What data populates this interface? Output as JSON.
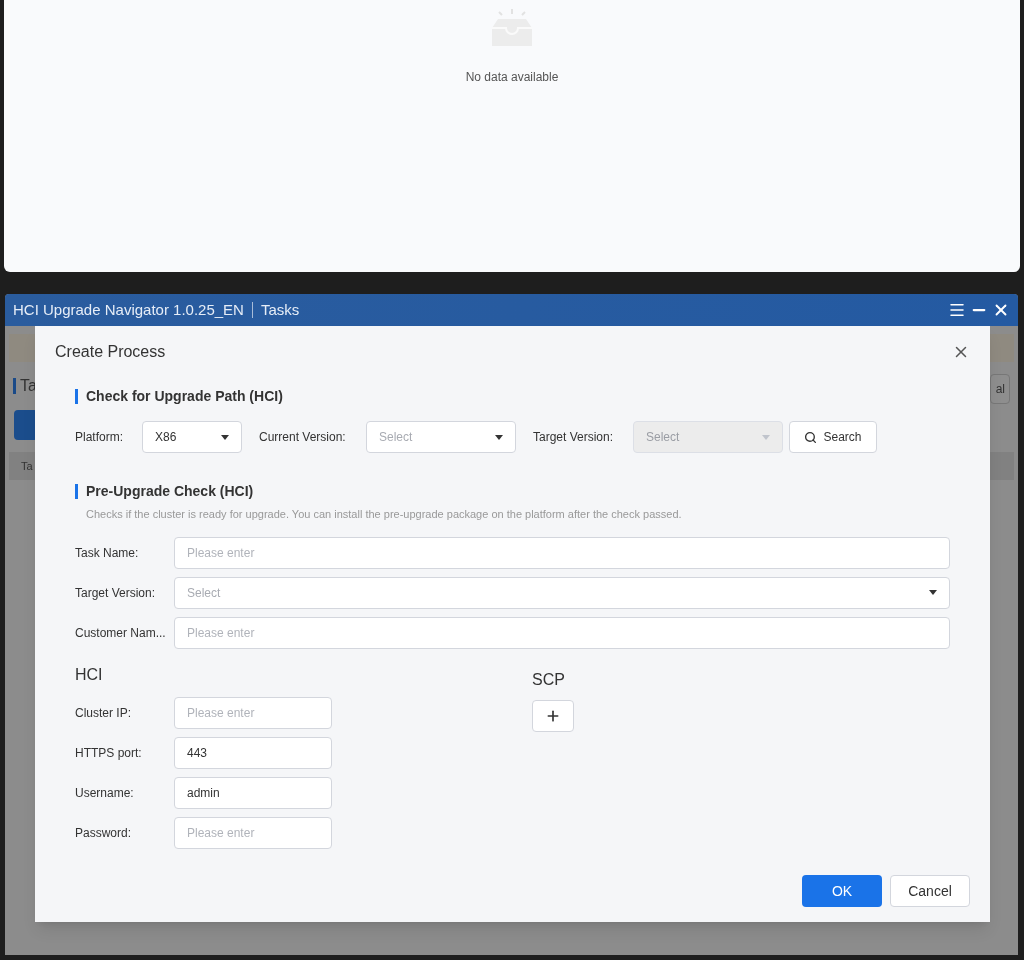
{
  "background_panel": {
    "empty_text": "No data available"
  },
  "app_window": {
    "title": "HCI Upgrade Navigator 1.0.25_EN",
    "section": "Tasks",
    "page_heading": "Ta",
    "column_1": "Ta",
    "button_1": "al"
  },
  "dialog": {
    "title": "Create Process",
    "path_section": {
      "heading": "Check for Upgrade Path (HCI)",
      "fields": [
        {
          "label": "Platform:",
          "value": "X86",
          "disabled": false
        },
        {
          "label": "Current Version:",
          "placeholder": "Select",
          "disabled": false
        },
        {
          "label": "Target Version:",
          "placeholder": "Select",
          "disabled": true
        }
      ],
      "search_button": "Search"
    },
    "precheck_section": {
      "heading": "Pre-Upgrade Check (HCI)",
      "description": "Checks if the cluster is ready for upgrade. You can install the pre-upgrade package on the platform after the check passed.",
      "fields": [
        {
          "label": "Task Name:",
          "kind": "input",
          "placeholder": "Please enter"
        },
        {
          "label": "Target Version:",
          "kind": "select",
          "placeholder": "Select"
        },
        {
          "label": "Customer Nam...",
          "kind": "input",
          "placeholder": "Please enter"
        }
      ]
    },
    "hci": {
      "heading": "HCI",
      "fields": [
        {
          "label": "Cluster IP:",
          "placeholder": "Please enter"
        },
        {
          "label": "HTTPS port:",
          "value": "443"
        },
        {
          "label": "Username:",
          "value": "admin"
        },
        {
          "label": "Password:",
          "placeholder": "Please enter"
        }
      ]
    },
    "scp": {
      "heading": "SCP"
    },
    "buttons": {
      "ok": "OK",
      "cancel": "Cancel"
    }
  }
}
